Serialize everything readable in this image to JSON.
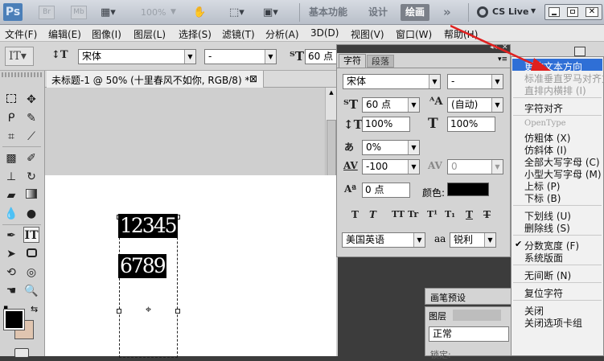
{
  "app_bar": {
    "logo": "Ps",
    "zoom": "100%",
    "workspaces": [
      "基本功能",
      "设计",
      "绘画"
    ],
    "active_workspace": "绘画",
    "more": "»",
    "cs_live": "CS Live"
  },
  "menu_bar": [
    "文件(F)",
    "编辑(E)",
    "图像(I)",
    "图层(L)",
    "选择(S)",
    "滤镜(T)",
    "分析(A)",
    "3D(D)",
    "视图(V)",
    "窗口(W)",
    "帮助(H)"
  ],
  "options_bar": {
    "font_family": "宋体",
    "font_style": "-",
    "font_size": "60 点"
  },
  "document_tab": {
    "title": "未标题-1 @ 50% (十里春风不如你, RGB/8) *",
    "close": "⊠"
  },
  "canvas": {
    "line1": "12345",
    "line2": "6789"
  },
  "character_panel": {
    "tab_active": "字符",
    "tab_inactive": "段落",
    "font_family": "宋体",
    "font_style": "-",
    "font_size": "60 点",
    "leading": "(自动)",
    "vertical_scale": "100%",
    "horizontal_scale": "100%",
    "tsume": "0%",
    "tracking": "-100",
    "kerning": "0",
    "baseline_shift": "0 点",
    "color_label": "颜色:",
    "color_value": "#000000",
    "style_buttons": [
      "T",
      "T",
      "TT",
      "Tr",
      "T¹",
      "T₁",
      "T",
      "T"
    ],
    "language": "美国英语",
    "aa_label": "aa",
    "antialias": "锐利"
  },
  "brush_panel": {
    "title": "画笔预设"
  },
  "layers_panel": {
    "tab_active": "图层",
    "blend_mode": "正常",
    "lock_label": "锁定:"
  },
  "context_menu": {
    "items": [
      {
        "label": "更改文本方向",
        "state": "highlighted"
      },
      {
        "label": "标准垂直罗马对齐方式",
        "state": "disabled"
      },
      {
        "label": "直排内横排 (I)",
        "state": "disabled"
      },
      {
        "label": "---"
      },
      {
        "label": "字符对齐",
        "state": "normal"
      },
      {
        "label": "---"
      },
      {
        "label": "OpenType",
        "state": "header"
      },
      {
        "label": "仿粗体 (X)",
        "state": "normal"
      },
      {
        "label": "仿斜体 (I)",
        "state": "normal"
      },
      {
        "label": "全部大写字母 (C)",
        "state": "normal"
      },
      {
        "label": "小型大写字母 (M)",
        "state": "normal"
      },
      {
        "label": "上标 (P)",
        "state": "normal"
      },
      {
        "label": "下标 (B)",
        "state": "normal"
      },
      {
        "label": "---"
      },
      {
        "label": "下划线 (U)",
        "state": "normal"
      },
      {
        "label": "删除线 (S)",
        "state": "normal"
      },
      {
        "label": "---"
      },
      {
        "label": "分数宽度 (F)",
        "state": "checked"
      },
      {
        "label": "系统版面",
        "state": "normal"
      },
      {
        "label": "---"
      },
      {
        "label": "无间断 (N)",
        "state": "normal"
      },
      {
        "label": "---"
      },
      {
        "label": "复位字符",
        "state": "normal"
      },
      {
        "label": "---"
      },
      {
        "label": "关闭",
        "state": "normal"
      },
      {
        "label": "关闭选项卡组",
        "state": "normal"
      }
    ]
  },
  "colors": {
    "foreground": "#000000",
    "background": "#e0c5b0",
    "highlight": "#2f6fd6",
    "arrow": "#e0201f"
  },
  "icons": [
    "move-icon",
    "marquee-icon",
    "lasso-icon",
    "quick-select-icon",
    "crop-icon",
    "eyedropper-icon",
    "healing-icon",
    "brush-icon",
    "stamp-icon",
    "history-brush-icon",
    "eraser-icon",
    "gradient-icon",
    "blur-icon",
    "dodge-icon",
    "pen-icon",
    "type-icon",
    "path-select-icon",
    "shape-icon",
    "3d-rotate-icon",
    "3d-orbit-icon",
    "hand-icon",
    "zoom-icon"
  ]
}
